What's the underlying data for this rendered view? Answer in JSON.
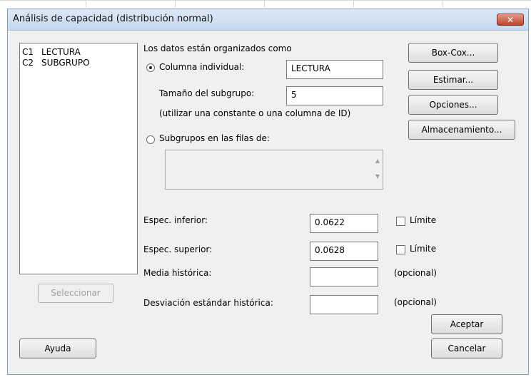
{
  "window": {
    "title": "Análisis de capacidad (distribución normal)",
    "close_label": "✕"
  },
  "variables": [
    {
      "id": "C1",
      "name": "LECTURA"
    },
    {
      "id": "C2",
      "name": "SUBGRUPO"
    }
  ],
  "data_org": {
    "heading": "Los datos están organizados como",
    "single_column": {
      "label": "Columna individual:",
      "value": "LECTURA",
      "selected": true
    },
    "subgroup_size": {
      "label": "Tamaño del subgrupo:",
      "value": "5"
    },
    "hint": "(utilizar una constante o una columna de ID)",
    "subgroups_rows": {
      "label": "Subgrupos en las filas de:",
      "value": "",
      "selected": false
    }
  },
  "specs": {
    "lower": {
      "label": "Espec. inferior:",
      "value": "0.0622",
      "limit_label": "Límite",
      "limit_checked": false
    },
    "upper": {
      "label": "Espec. superior:",
      "value": "0.0628",
      "limit_label": "Límite",
      "limit_checked": false
    },
    "hist_mean": {
      "label": "Media histórica:",
      "value": "",
      "note": "(opcional)"
    },
    "hist_std": {
      "label": "Desviación estándar histórica:",
      "value": "",
      "note": "(opcional)"
    }
  },
  "buttons": {
    "box_cox": "Box-Cox...",
    "estimate": "Estimar...",
    "options": "Opciones...",
    "storage": "Almacenamiento...",
    "select": "Seleccionar",
    "help": "Ayuda",
    "ok": "Aceptar",
    "cancel": "Cancelar"
  },
  "colors": {
    "title_bar": "#c6d8ee",
    "dialog_bg": "#f0f0f0",
    "close_button": "#c0432b"
  }
}
